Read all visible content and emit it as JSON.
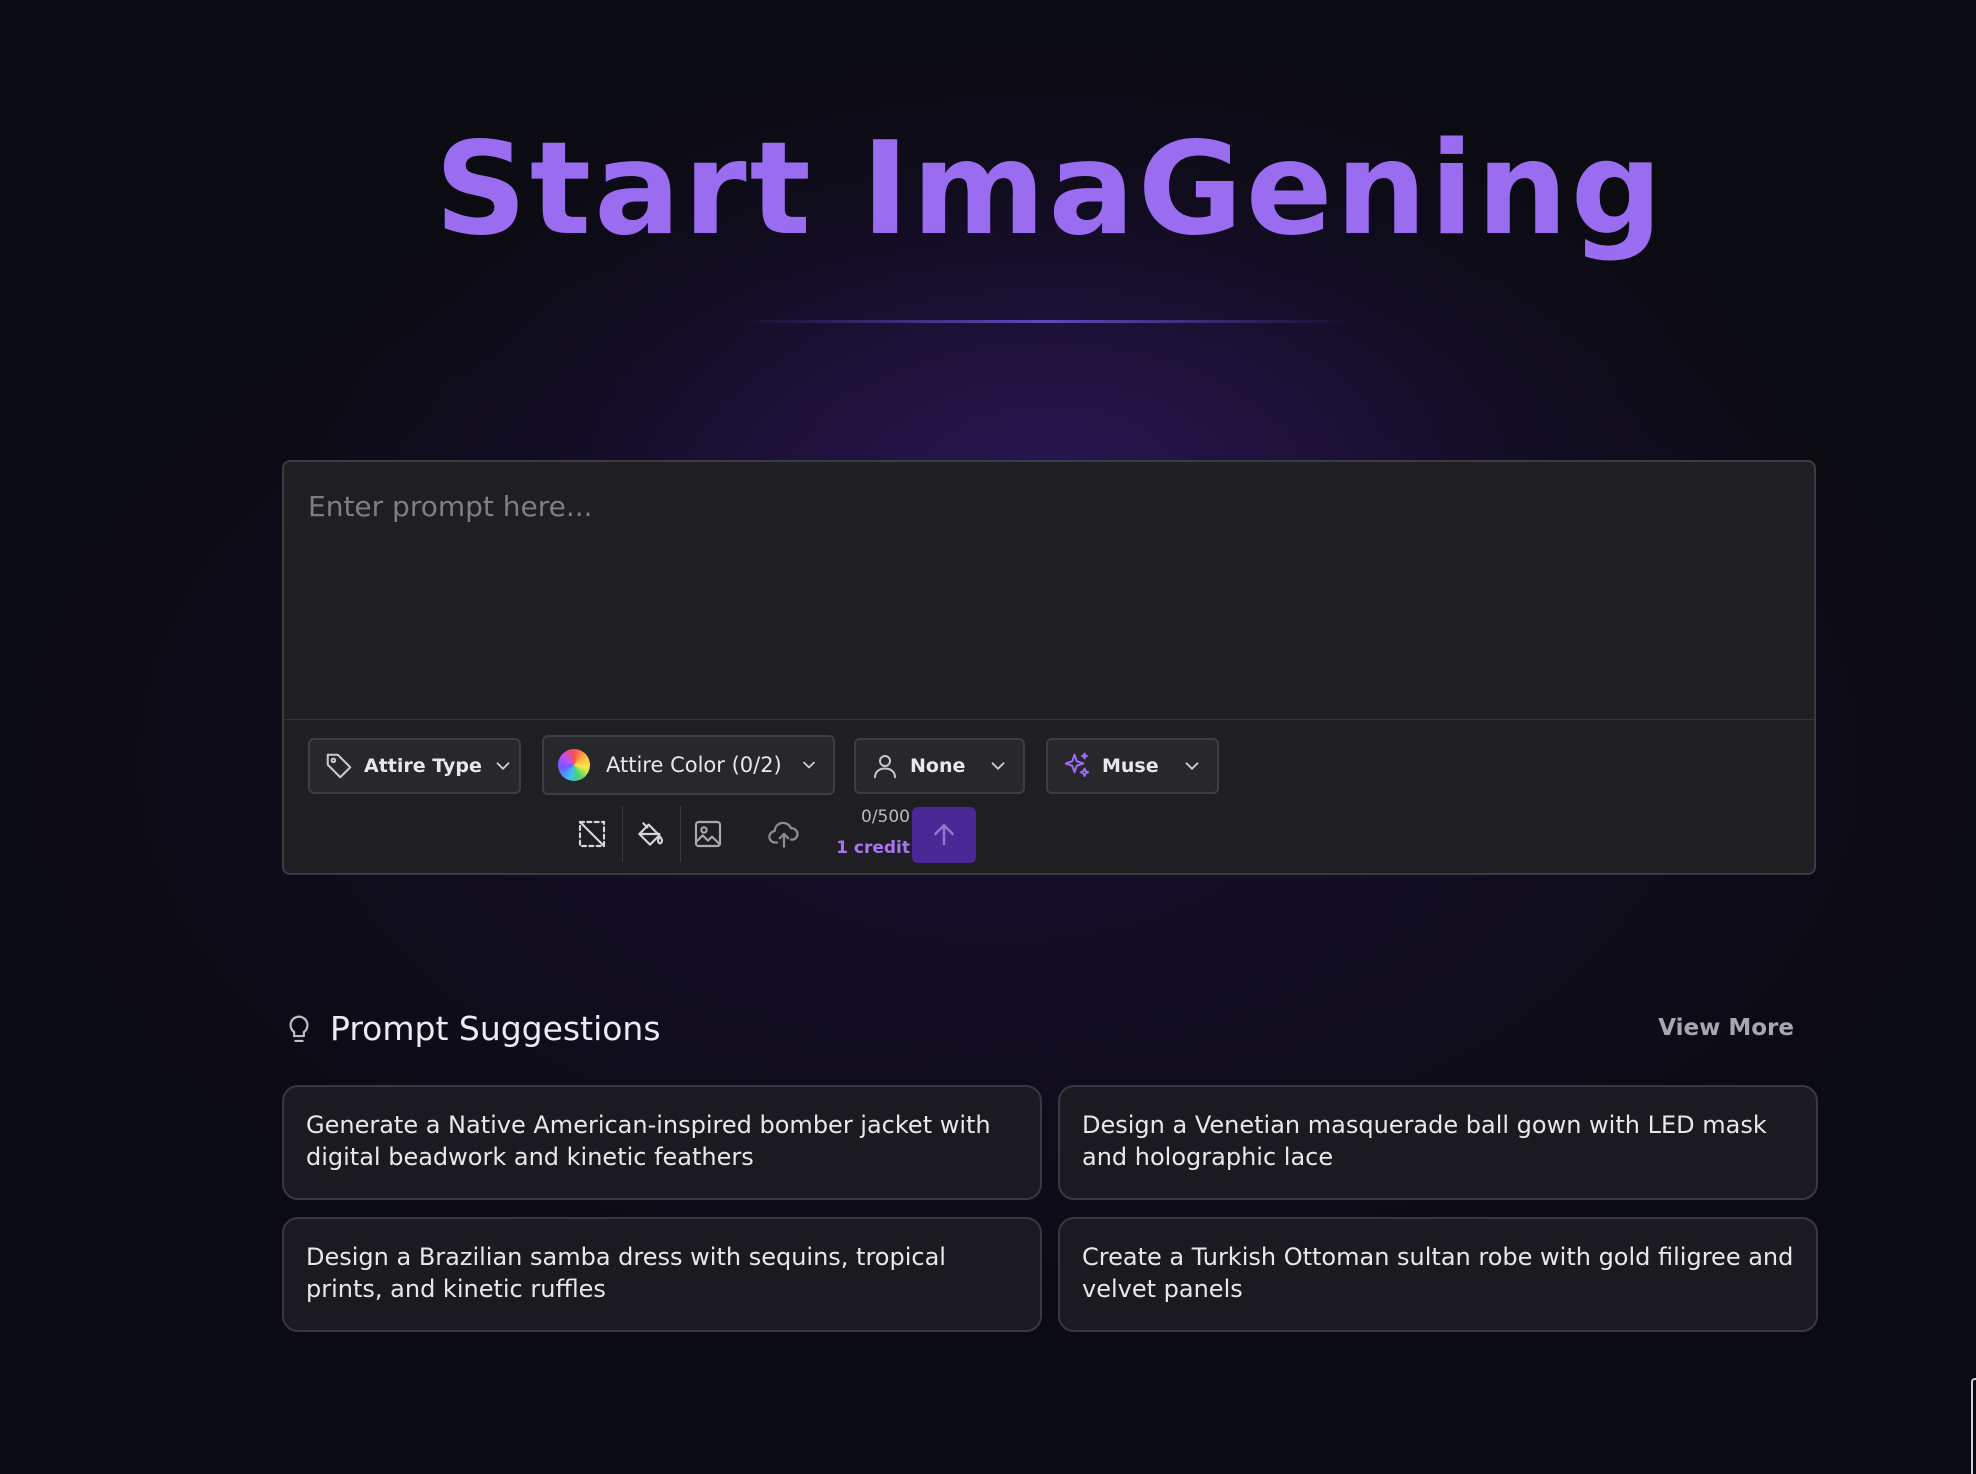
{
  "hero": {
    "title": "Start ImaGening"
  },
  "prompt": {
    "placeholder": "Enter prompt here...",
    "value": ""
  },
  "filters": {
    "attire_type": {
      "label": "Attire Type",
      "icon": "tag-icon"
    },
    "attire_color": {
      "label": "Attire Color (0/2)",
      "icon": "color-wheel-icon"
    },
    "model": {
      "label": "None",
      "icon": "user-icon"
    },
    "muse": {
      "label": "Muse",
      "icon": "sparkles-icon"
    }
  },
  "tools": [
    {
      "icon": "select-area-icon"
    },
    {
      "icon": "paint-bucket-icon"
    },
    {
      "icon": "image-icon"
    },
    {
      "icon": "cloud-upload-icon"
    }
  ],
  "counter": {
    "chars": "0/500",
    "credit": "1 credit"
  },
  "colors": {
    "accent": "#9a6cf0",
    "credit": "#a874f2",
    "send_button": "#4a2896",
    "panel": "#1f1f23",
    "background": "#0b0b12"
  },
  "suggestions": {
    "title": "Prompt Suggestions",
    "view_more": "View More",
    "items": [
      "Generate a Native American-inspired bomber jacket with digital beadwork and kinetic feathers",
      "Design a Venetian masquerade ball gown with LED mask and holographic lace",
      "Design a Brazilian samba dress with sequins, tropical prints, and kinetic ruffles",
      "Create a Turkish Ottoman sultan robe with gold filigree and velvet panels"
    ]
  }
}
